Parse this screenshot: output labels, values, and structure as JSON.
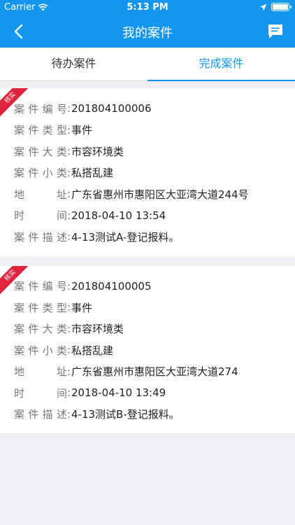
{
  "status_bar": {
    "carrier": "Carrier",
    "time": "5:13 PM"
  },
  "nav": {
    "title": "我的案件"
  },
  "tabs": [
    {
      "label": "待办案件",
      "active": false
    },
    {
      "label": "完成案件",
      "active": true
    }
  ],
  "colors": {
    "primary": "#1296ee",
    "ribbon": "#e0243d"
  },
  "cases": [
    {
      "badge": "核实",
      "fields": [
        {
          "label": "案件编号",
          "value": "201804100006"
        },
        {
          "label": "案件类型",
          "value": "事件"
        },
        {
          "label": "案件大类",
          "value": "市容环境类"
        },
        {
          "label": "案件小类",
          "value": "私搭乱建"
        },
        {
          "label": "地址",
          "value": "广东省惠州市惠阳区大亚湾大道244号"
        },
        {
          "label": "时间",
          "value": "2018-04-10 13:54"
        },
        {
          "label": "案件描述",
          "value": "4-13测试A-登记报料。"
        }
      ]
    },
    {
      "badge": "核实",
      "fields": [
        {
          "label": "案件编号",
          "value": "201804100005"
        },
        {
          "label": "案件类型",
          "value": "事件"
        },
        {
          "label": "案件大类",
          "value": "市容环境类"
        },
        {
          "label": "案件小类",
          "value": "私搭乱建"
        },
        {
          "label": "地址",
          "value": "广东省惠州市惠阳区大亚湾大道274"
        },
        {
          "label": "时间",
          "value": "2018-04-10 13:49"
        },
        {
          "label": "案件描述",
          "value": "4-13测试B-登记报料。"
        }
      ]
    }
  ]
}
